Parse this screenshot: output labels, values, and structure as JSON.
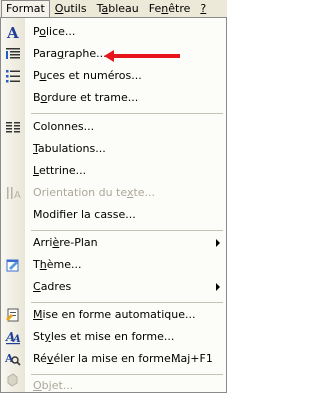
{
  "menubar": [
    {
      "label": "Format",
      "ul": "",
      "active": true
    },
    {
      "label": "Outils",
      "ul": "O"
    },
    {
      "label": "Tableau",
      "ul": "a"
    },
    {
      "label": "Fenêtre",
      "ul": "n"
    },
    {
      "label": "?",
      "ul": ""
    }
  ],
  "menu": {
    "items": [
      {
        "id": "police",
        "pre": "P",
        "u": "o",
        "post": "lice...",
        "icon": "font-a-icon",
        "enabled": true
      },
      {
        "id": "paragraphe",
        "pre": "Para",
        "u": "g",
        "post": "raphe...",
        "icon": "paragraph-icon",
        "enabled": true
      },
      {
        "id": "puces",
        "pre": "P",
        "u": "u",
        "post": "ces et numéros...",
        "icon": "bullets-icon",
        "enabled": true
      },
      {
        "id": "bordure",
        "pre": "B",
        "u": "o",
        "post": "rdure et trame...",
        "icon": "",
        "enabled": true
      },
      {
        "id": "colonnes",
        "pre": "Colonnes...",
        "u": "",
        "post": "",
        "icon": "columns-icon",
        "enabled": true
      },
      {
        "id": "tabulations",
        "pre": "",
        "u": "T",
        "post": "abulations...",
        "icon": "",
        "enabled": true
      },
      {
        "id": "lettrine",
        "pre": "",
        "u": "L",
        "post": "ettrine...",
        "icon": "",
        "enabled": true
      },
      {
        "id": "orientation",
        "pre": "Orientation du te",
        "u": "x",
        "post": "te...",
        "icon": "text-direction-icon",
        "enabled": false
      },
      {
        "id": "modifier-casse",
        "pre": "Modifier la casse...",
        "u": "",
        "post": "",
        "icon": "",
        "enabled": true
      },
      {
        "id": "arriere-plan",
        "pre": "Arri",
        "u": "è",
        "post": "re-Plan",
        "icon": "",
        "enabled": true,
        "submenu": true
      },
      {
        "id": "theme",
        "pre": "T",
        "u": "h",
        "post": "ème...",
        "icon": "theme-icon",
        "enabled": true
      },
      {
        "id": "cadres",
        "pre": "",
        "u": "C",
        "post": "adres",
        "icon": "",
        "enabled": true,
        "submenu": true
      },
      {
        "id": "mise-en-forme-auto",
        "pre": "",
        "u": "M",
        "post": "ise en forme automatique...",
        "icon": "autoformat-icon",
        "enabled": true
      },
      {
        "id": "styles",
        "pre": "St",
        "u": "y",
        "post": "les et mise en forme...",
        "icon": "styles-icon",
        "enabled": true
      },
      {
        "id": "reveler",
        "pre": "Ré",
        "u": "v",
        "post": "éler la mise en forme...",
        "icon": "reveal-format-icon",
        "enabled": true,
        "shortcut": "Maj+F1"
      },
      {
        "id": "objet",
        "pre": "",
        "u": "O",
        "post": "bjet...",
        "icon": "object-icon",
        "enabled": false
      }
    ]
  },
  "colors": {
    "pointer_arrow": "#e8141b",
    "disabled_text": "#aca899"
  }
}
